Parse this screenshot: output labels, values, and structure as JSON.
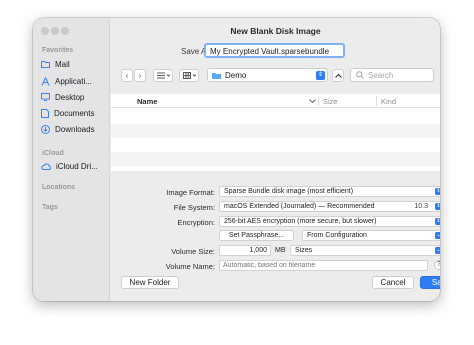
{
  "window": {
    "title": "New Blank Disk Image"
  },
  "sidebar": {
    "favorites_heading": "Favorites",
    "favorites": [
      {
        "label": "Mail",
        "icon": "folder-icon"
      },
      {
        "label": "Applicati...",
        "icon": "applications-icon"
      },
      {
        "label": "Desktop",
        "icon": "desktop-icon"
      },
      {
        "label": "Documents",
        "icon": "document-icon"
      },
      {
        "label": "Downloads",
        "icon": "download-icon"
      }
    ],
    "icloud_heading": "iCloud",
    "icloud_items": [
      {
        "label": "iCloud Dri...",
        "icon": "cloud-icon"
      }
    ],
    "locations_heading": "Locations",
    "tags_heading": "Tags"
  },
  "save_as": {
    "label": "Save As:",
    "value": "My Encrypted Vault.sparsebundle"
  },
  "toolbar": {
    "back": "‹",
    "forward": "›",
    "location": "Demo",
    "search_placeholder": "Search"
  },
  "list": {
    "columns": {
      "name": "Name",
      "size": "Size",
      "kind": "Kind"
    }
  },
  "options": {
    "image_format": {
      "label": "Image Format:",
      "value": "Sparse Bundle disk image (most efficient)"
    },
    "file_system": {
      "label": "File System:",
      "value": "macOS Extended (Journaled) — Recommended",
      "version": "10.3"
    },
    "encryption": {
      "label": "Encryption:",
      "value": "256-bit AES encryption (more secure, but slower)"
    },
    "set_passphrase": "Set Passphrase...",
    "from_configuration": "From Configuration",
    "volume_size": {
      "label": "Volume Size:",
      "value": "1,000",
      "unit": "MB",
      "preset": "Sizes"
    },
    "volume_name": {
      "label": "Volume Name:",
      "placeholder": "Automatic, based on filename"
    },
    "help": "?"
  },
  "footer": {
    "new_folder": "New Folder",
    "cancel": "Cancel",
    "save": "Save"
  },
  "colors": {
    "accent": "#2f7df6",
    "focus_ring": "#7fb0f0"
  }
}
